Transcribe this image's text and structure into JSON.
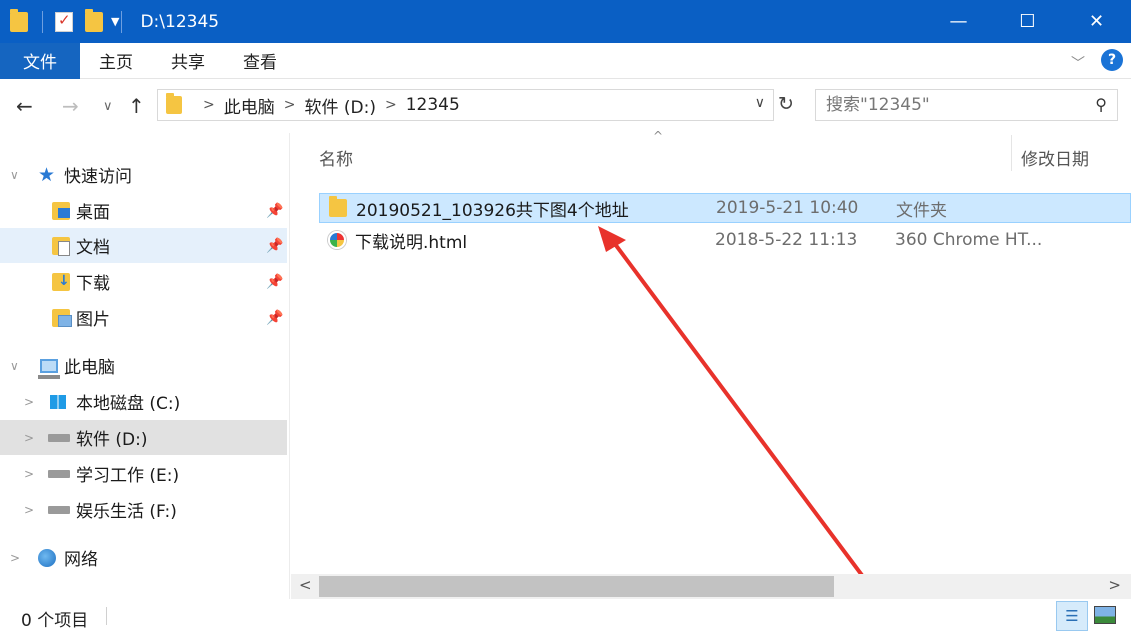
{
  "window": {
    "title": "D:\\12345",
    "controls": {
      "minimize": "—",
      "maximize": "☐",
      "close": "✕"
    }
  },
  "ribbon": {
    "tabs": [
      {
        "label": "文件"
      },
      {
        "label": "主页"
      },
      {
        "label": "共享"
      },
      {
        "label": "查看"
      }
    ],
    "help_glyph": "?"
  },
  "address": {
    "breadcrumbs": [
      "此电脑",
      "软件 (D:)",
      "12345"
    ],
    "search_placeholder": "搜索\"12345\""
  },
  "nav": {
    "quick_access": "快速访问",
    "quick_items": [
      {
        "label": "桌面"
      },
      {
        "label": "文档"
      },
      {
        "label": "下载"
      },
      {
        "label": "图片"
      }
    ],
    "this_pc": "此电脑",
    "drives": [
      {
        "label": "本地磁盘 (C:)"
      },
      {
        "label": "软件 (D:)"
      },
      {
        "label": "学习工作 (E:)"
      },
      {
        "label": "娱乐生活 (F:)"
      }
    ],
    "network": "网络"
  },
  "content": {
    "columns": {
      "name": "名称",
      "date": "修改日期"
    },
    "rows": [
      {
        "name": "20190521_103926共下图4个地址",
        "date": "2019-5-21 10:40",
        "type": "文件夹",
        "icon": "folder-icon",
        "selected": true
      },
      {
        "name": "下载说明.html",
        "date": "2018-5-22 11:13",
        "type": "360 Chrome HT...",
        "icon": "chrome-html-icon",
        "selected": false
      }
    ]
  },
  "status": {
    "item_count": "0 个项目"
  },
  "colors": {
    "titlebar": "#0a5fc4",
    "file_tab": "#1565c0",
    "selection": "#cce8ff",
    "arrow": "#e8322b"
  }
}
